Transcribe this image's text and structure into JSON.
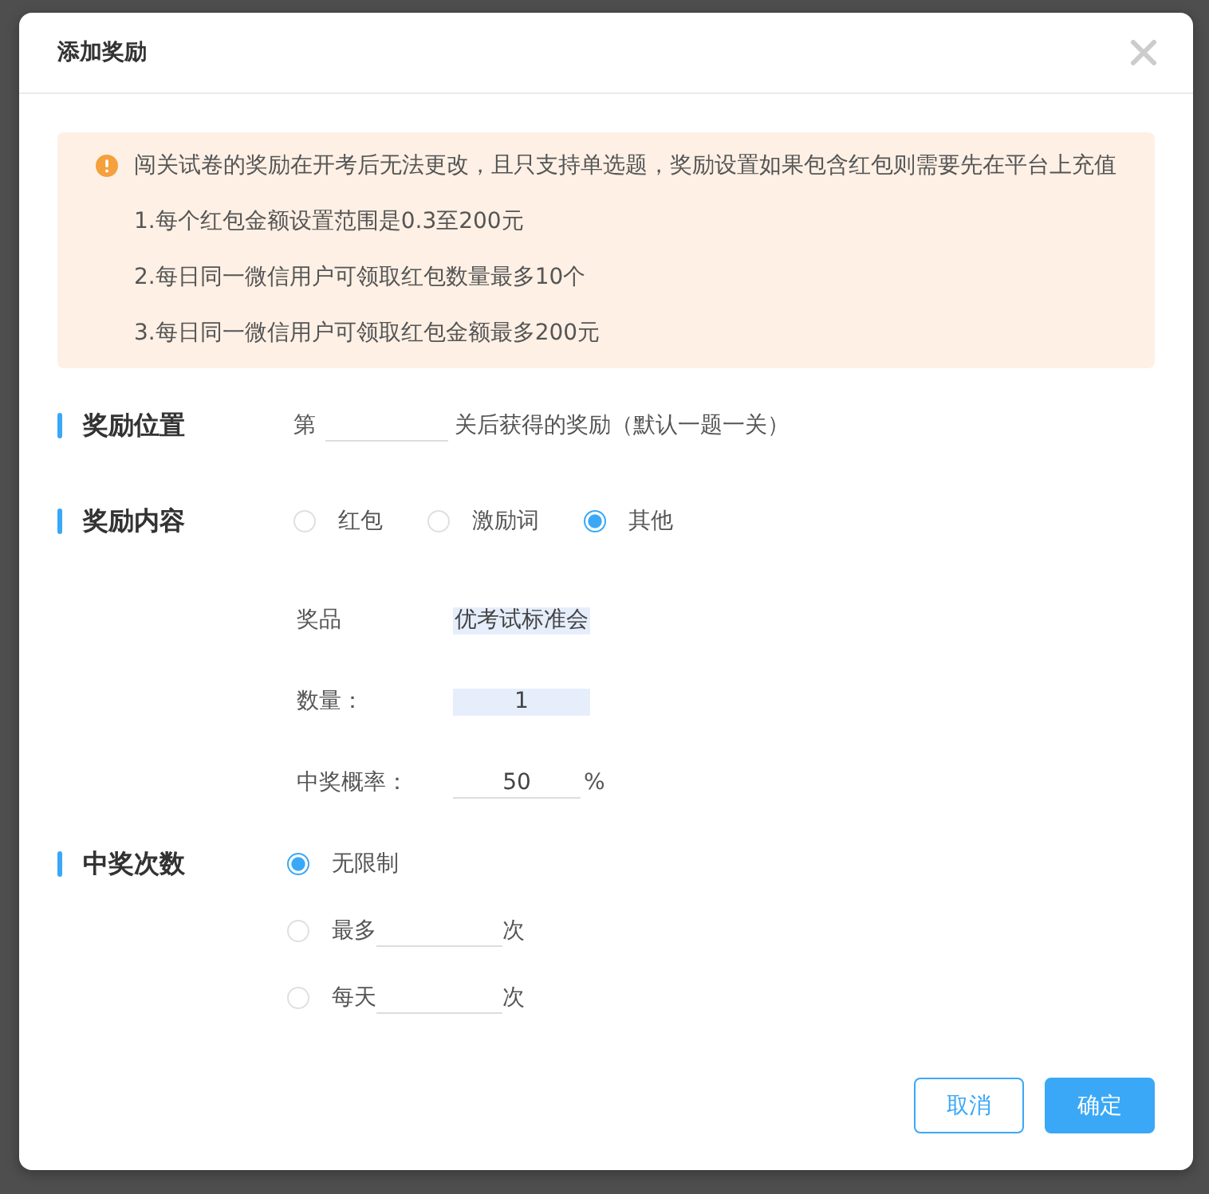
{
  "dialog": {
    "title": "添加奖励"
  },
  "notice": {
    "message": "闯关试卷的奖励在开考后无法更改，且只支持单选题，奖励设置如果包含红包则需要先在平台上充值",
    "items": [
      "1.每个红包金额设置范围是0.3至200元",
      "2.每日同一微信用户可领取红包数量最多10个",
      "3.每日同一微信用户可领取红包金额最多200元"
    ]
  },
  "sections": [
    {
      "kind": "position",
      "title": "奖励位置",
      "prefix": "第",
      "suffix": "关后获得的奖励（默认一题一关）"
    },
    {
      "kind": "choice",
      "title": "奖励内容",
      "options": [
        {
          "label": "红包",
          "selected": false
        },
        {
          "label": "激励词",
          "selected": false
        },
        {
          "label": "其他",
          "selected": true
        }
      ],
      "fields": [
        {
          "kind": "filled",
          "label": "奖品",
          "value": "优考试标准会"
        },
        {
          "kind": "filled",
          "label": "数量：",
          "value": "1"
        },
        {
          "kind": "underline",
          "label": "中奖概率：",
          "value": "50",
          "unit": "%"
        }
      ]
    },
    {
      "kind": "limit",
      "title": "中奖次数",
      "options": [
        {
          "kind": "plain",
          "label": "无限制",
          "selected": true
        },
        {
          "kind": "count",
          "label": "最多",
          "unit": "次",
          "selected": false
        },
        {
          "kind": "count",
          "label": "每天",
          "unit": "次",
          "selected": false
        }
      ]
    }
  ],
  "buttons": [
    {
      "kind": "secondary",
      "label": "取消"
    },
    {
      "kind": "primary",
      "label": "确定"
    }
  ]
}
